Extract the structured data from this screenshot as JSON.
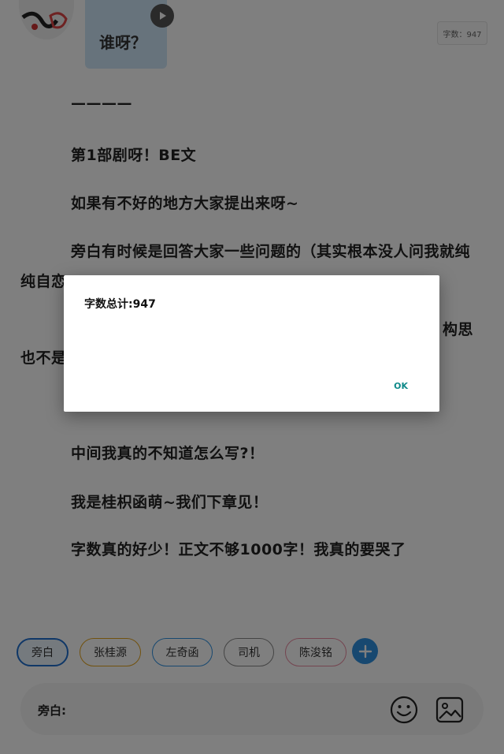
{
  "chat": {
    "bubble_text": "谁呀？",
    "word_count_badge": "字数：947"
  },
  "article": {
    "lines": [
      "————",
      "第1部剧呀！BE文",
      "如果有不好的地方大家提出来呀~",
      "旁白有时候是回答大家一些问题的（其实根本没人问我就纯",
      "纯自恋",
      "构思",
      "也不是",
      "中间我真的不知道怎么写?！",
      "我是桂枳函萌~我们下章见！",
      "字数真的好少！正文不够1000字！我真的要哭了"
    ]
  },
  "dialog": {
    "message": "字数总计:947",
    "ok_label": "OK"
  },
  "roles": {
    "items": [
      {
        "label": "旁白",
        "color": "#1f6fcf",
        "selected": true
      },
      {
        "label": "张桂源",
        "color": "#e2a21b",
        "selected": false
      },
      {
        "label": "左奇函",
        "color": "#2e90e0",
        "selected": false
      },
      {
        "label": "司机",
        "color": "#888888",
        "selected": false
      },
      {
        "label": "陈浚铭",
        "color": "#e88aa0",
        "selected": false
      }
    ],
    "add_icon": "plus-icon"
  },
  "input": {
    "label": "旁白:",
    "emoji_icon": "smiley-icon",
    "image_icon": "image-icon"
  },
  "colors": {
    "accent": "#2e90e0",
    "dialog_button": "#0f8a8a",
    "bubble": "#cfe6f8"
  }
}
